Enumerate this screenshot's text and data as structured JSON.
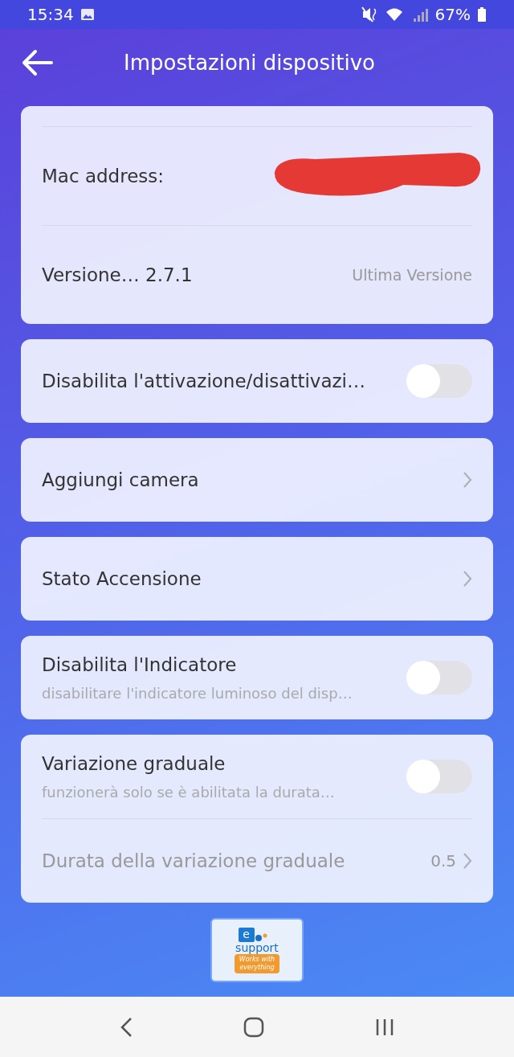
{
  "status_bar": {
    "time": "15:34",
    "battery": "67%"
  },
  "header": {
    "title": "Impostazioni dispositivo"
  },
  "cards": [
    {
      "rows": [
        {
          "kind": "cut"
        },
        {
          "kind": "info",
          "label": "Mac address:",
          "redacted": true
        },
        {
          "kind": "info",
          "label": "Versione… 2.7.1",
          "value": "Ultima Versione"
        }
      ]
    },
    {
      "rows": [
        {
          "kind": "toggle",
          "label": "Disabilita l'attivazione/disattivazi…",
          "on": false
        }
      ]
    },
    {
      "rows": [
        {
          "kind": "link",
          "label": "Aggiungi camera",
          "disabled": false
        }
      ]
    },
    {
      "rows": [
        {
          "kind": "link",
          "label": "Stato Accensione",
          "disabled": false
        }
      ]
    },
    {
      "rows": [
        {
          "kind": "toggle",
          "label": "Disabilita l'Indicatore",
          "subtitle": "disabilitare l'indicatore luminoso del disp…",
          "on": false
        }
      ]
    },
    {
      "rows": [
        {
          "kind": "toggle",
          "label": "Variazione graduale",
          "subtitle": "funzionerà solo se è abilitata la durata…",
          "on": false
        },
        {
          "kind": "link",
          "label": "Durata della variazione graduale",
          "value": "0.5",
          "disabled": true
        }
      ]
    }
  ],
  "badge": {
    "brand": "support",
    "tagline_1": "Works with",
    "tagline_2": "everything",
    "letter": "e"
  }
}
